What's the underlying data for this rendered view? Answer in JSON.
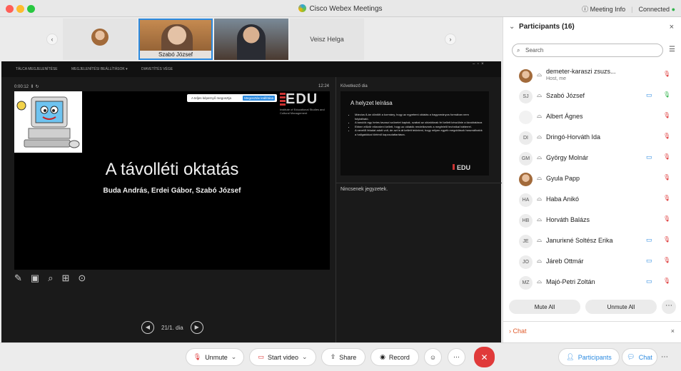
{
  "app": {
    "title": "Cisco Webex Meetings",
    "meeting_info": "Meeting Info",
    "connection": "Connected"
  },
  "video_strip": {
    "speaker_name": "Szabó József",
    "other_name": "Veisz Helga"
  },
  "presentation": {
    "toolbar": [
      "TÁLCA MEGJELENÍTÉSE",
      "MEGJELENÍTÉSI BEÁLLÍTÁSOK ▾",
      "DIAVETÍTÉS VÉGE"
    ],
    "elapsed": "0:00:12",
    "clock": "12:24",
    "popup_text": "A teljes képernyő megosztja",
    "popup_btn": "Megosztás leállítása",
    "slide_title": "A távolléti oktatás",
    "slide_authors": "Buda András, Erdei Gábor, Szabó József",
    "logo_text": "EDU",
    "logo_sub": "Institute of Educational Studies and Cultural Management",
    "next_label": "Következő dia",
    "next_title": "A helyzet leírása",
    "next_bullets": [
      "Március 8-án döntött a kormány, hogy az egyetemi oktatás a hagyományos formában nem folytatható.",
      "A tanulók egy hetes tavaszi szünetet kaptak, szabat az oktatóknak fel kellett készülnie a távoktatásra",
      "Ebben előzőr elkezdeni kellett, hogy az oktatók rendelkeznek a megfelelő technikai hátterrel.",
      "A nevelői feladat adott volt, de azt is át kellett tekinteni, hogy milyen egyéb megoldások használhatók a hallgatókkal történő kapcsolattartásra."
    ],
    "notes": "Nincsenek jegyzetek.",
    "counter": "21/1. dia"
  },
  "participants": {
    "header": "Participants (16)",
    "search_placeholder": "Search",
    "list": [
      {
        "initials": "",
        "name": "demeter-karaszi zsuzs...",
        "sub": "Host, me"
      },
      {
        "initials": "SJ",
        "name": "Szabó József",
        "sub": ""
      },
      {
        "initials": "",
        "name": "Albert Ágnes",
        "sub": ""
      },
      {
        "initials": "DI",
        "name": "Dringó-Horváth Ida",
        "sub": ""
      },
      {
        "initials": "GM",
        "name": "György Molnár",
        "sub": ""
      },
      {
        "initials": "",
        "name": "Gyula Papp",
        "sub": ""
      },
      {
        "initials": "HA",
        "name": "Haba Anikó",
        "sub": ""
      },
      {
        "initials": "HB",
        "name": "Horváth Balázs",
        "sub": ""
      },
      {
        "initials": "JE",
        "name": "Januriкné Soltész Erika",
        "sub": ""
      },
      {
        "initials": "JO",
        "name": "Járeb Ottmár",
        "sub": ""
      },
      {
        "initials": "MZ",
        "name": "Majó-Petri Zoltán",
        "sub": ""
      }
    ],
    "mute_all": "Mute All",
    "unmute_all": "Unmute All",
    "chat": "Chat"
  },
  "controls": {
    "unmute": "Unmute",
    "start_video": "Start video",
    "share": "Share",
    "record": "Record",
    "participants": "Participants",
    "chat": "Chat"
  },
  "colors": {
    "accent": "#2b8ae0",
    "end": "#e03a3a",
    "muted": "#d33"
  }
}
